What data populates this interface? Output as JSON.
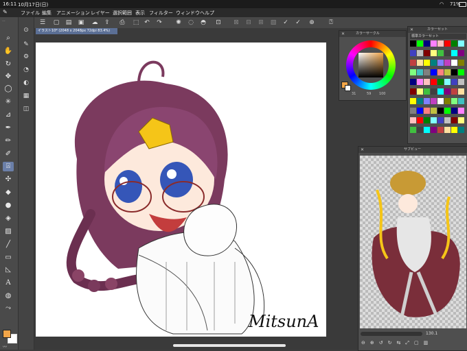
{
  "status": {
    "time": "16:11",
    "date": "10月17日(日)",
    "battery": "71%"
  },
  "menu": {
    "items": [
      "ファイル",
      "編集",
      "アニメーション",
      "レイヤー",
      "選択範囲",
      "表示",
      "フィルター",
      "ウィンドウ",
      "ヘルプ"
    ]
  },
  "document": {
    "tab_label": "イラスト10* (2048 x 2048px 72dpi 83.4%)"
  },
  "canvas": {
    "signature": "MitsunA"
  },
  "panels": {
    "color_circle": {
      "title": "カラーサークル",
      "h": "31",
      "s": "59",
      "v": "100"
    },
    "color_set": {
      "title": "カラーセット",
      "dropdown": "標準カラーセット"
    },
    "navigator": {
      "title": "サブビュー",
      "value": "130.1"
    }
  },
  "colors": {
    "main_color": "#f2a548",
    "sub_color": "#ffffff",
    "accent_tool": "#6b7fa8"
  },
  "icons": {
    "tools": [
      "zoom-icon",
      "hand-icon",
      "rotate-icon",
      "move-icon",
      "select-icon",
      "wand-icon",
      "eyedropper-icon",
      "pen-icon",
      "pencil-icon",
      "brush-icon",
      "airbrush-icon",
      "decoration-icon",
      "eraser-icon",
      "blend-icon",
      "fill-icon",
      "gradient-icon",
      "figure-icon",
      "frame-icon",
      "ruler-icon",
      "text-icon",
      "balloon-icon",
      "line-correct-icon"
    ]
  }
}
